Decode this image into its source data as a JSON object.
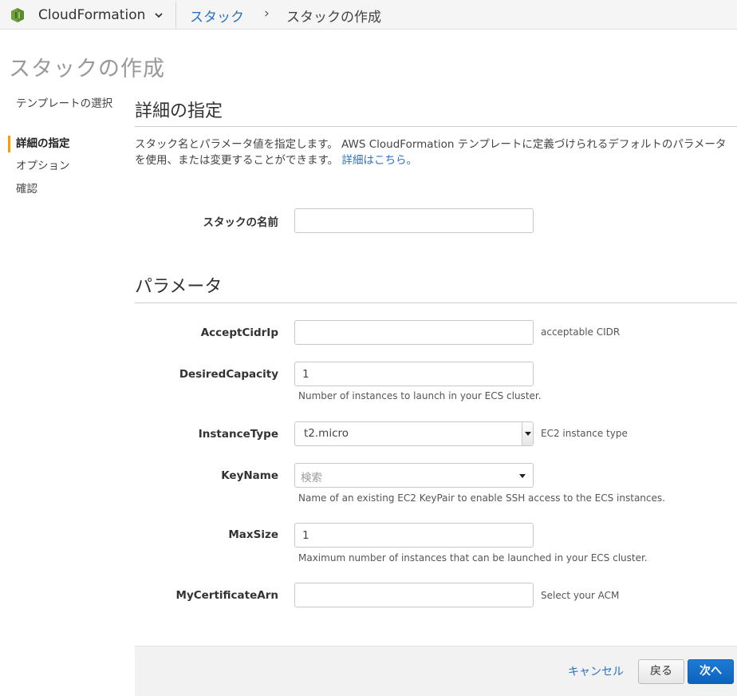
{
  "nav": {
    "service": "CloudFormation",
    "breadcrumb_link": "スタック",
    "breadcrumb_separator": "›",
    "breadcrumb_current": "スタックの作成"
  },
  "page_title": "スタックの作成",
  "steps": [
    {
      "label": "テンプレートの選択",
      "active": false
    },
    {
      "label": "詳細の指定",
      "active": true
    },
    {
      "label": "オプション",
      "active": false
    },
    {
      "label": "確認",
      "active": false
    }
  ],
  "details": {
    "title": "詳細の指定",
    "description_line1": "スタック名とパラメータ値を指定します。 AWS CloudFormation テンプレートに定義づけられるデフォルトのパラメータ",
    "description_line2": "を使用、または変更することができます。",
    "learn_more": "詳細はこちら。",
    "stack_name_label": "スタックの名前",
    "stack_name_value": ""
  },
  "parameters": {
    "title": "パラメータ",
    "accept_cidr": {
      "label": "AcceptCidrIp",
      "value": "",
      "hint": "acceptable CIDR"
    },
    "desired_capacity": {
      "label": "DesiredCapacity",
      "value": "1",
      "hint": "Number of instances to launch in your ECS cluster."
    },
    "instance_type": {
      "label": "InstanceType",
      "value": "t2.micro",
      "hint": "EC2 instance type"
    },
    "key_name": {
      "label": "KeyName",
      "placeholder": "検索",
      "hint": "Name of an existing EC2 KeyPair to enable SSH access to the ECS instances."
    },
    "max_size": {
      "label": "MaxSize",
      "value": "1",
      "hint": "Maximum number of instances that can be launched in your ECS cluster."
    },
    "my_certificate_arn": {
      "label": "MyCertificateArn",
      "value": "",
      "hint": "Select your ACM"
    }
  },
  "footer": {
    "cancel": "キャンセル",
    "back": "戻る",
    "next": "次へ"
  },
  "colors": {
    "link": "#2a72c4",
    "accent": "#ff9900",
    "primary_button": "#0d63bd"
  }
}
